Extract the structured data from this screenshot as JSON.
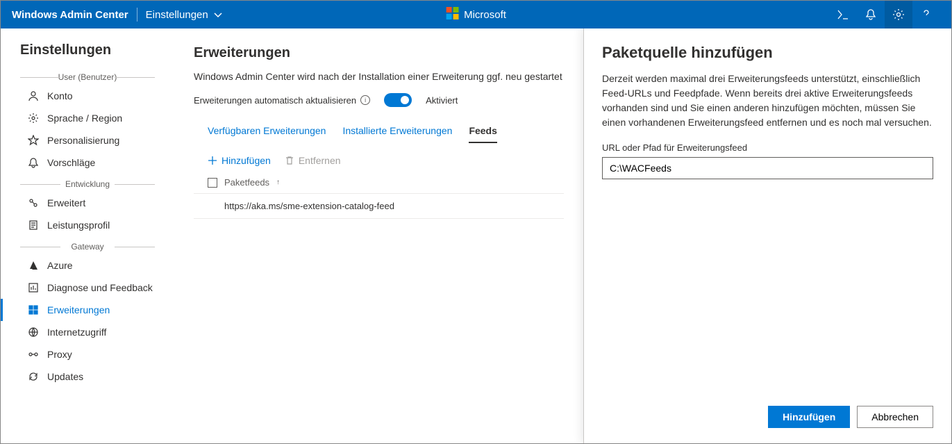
{
  "topbar": {
    "title": "Windows Admin Center",
    "settings_label": "Einstellungen",
    "brand": "Microsoft"
  },
  "sidebar": {
    "heading": "Einstellungen",
    "groups": [
      {
        "label": "User (Benutzer)",
        "items": [
          {
            "icon": "person",
            "label": "Konto"
          },
          {
            "icon": "gear",
            "label": "Sprache / Region"
          },
          {
            "icon": "star",
            "label": "Personalisierung"
          },
          {
            "icon": "bell",
            "label": "Vorschläge"
          }
        ]
      },
      {
        "label": "Entwicklung",
        "items": [
          {
            "icon": "wrench",
            "label": "Erweitert"
          },
          {
            "icon": "doc",
            "label": "Leistungsprofil"
          }
        ]
      },
      {
        "label": "Gateway",
        "items": [
          {
            "icon": "azure",
            "label": "Azure"
          },
          {
            "icon": "chart",
            "label": "Diagnose und Feedback"
          },
          {
            "icon": "grid",
            "label": "Erweiterungen",
            "selected": true
          },
          {
            "icon": "globe",
            "label": "Internetzugriff"
          },
          {
            "icon": "proxy",
            "label": "Proxy"
          },
          {
            "icon": "refresh",
            "label": "Updates"
          }
        ]
      }
    ]
  },
  "main": {
    "heading": "Erweiterungen",
    "subtitle": "Windows Admin Center wird nach der Installation einer Erweiterung ggf. neu gestartet",
    "auto_update_label": "Erweiterungen automatisch aktualisieren",
    "toggle_state": "Aktiviert",
    "tabs": [
      "Verfügbaren Erweiterungen",
      "Installierte Erweiterungen",
      "Feeds"
    ],
    "active_tab": 2,
    "toolbar": {
      "add": "Hinzufügen",
      "remove": "Entfernen"
    },
    "table": {
      "column": "Paketfeeds",
      "rows": [
        "https://aka.ms/sme-extension-catalog-feed"
      ]
    }
  },
  "panel": {
    "heading": "Paketquelle hinzufügen",
    "description": "Derzeit werden maximal drei Erweiterungsfeeds unterstützt, einschließlich Feed-URLs und Feedpfade. Wenn bereits drei aktive Erweiterungsfeeds vorhanden sind und Sie einen anderen hinzufügen möchten, müssen Sie einen vorhandenen Erweiterungsfeed entfernen und es noch mal versuchen.",
    "input_label": "URL oder Pfad für Erweiterungsfeed",
    "input_value": "C:\\WACFeeds",
    "submit": "Hinzufügen",
    "cancel": "Abbrechen"
  }
}
